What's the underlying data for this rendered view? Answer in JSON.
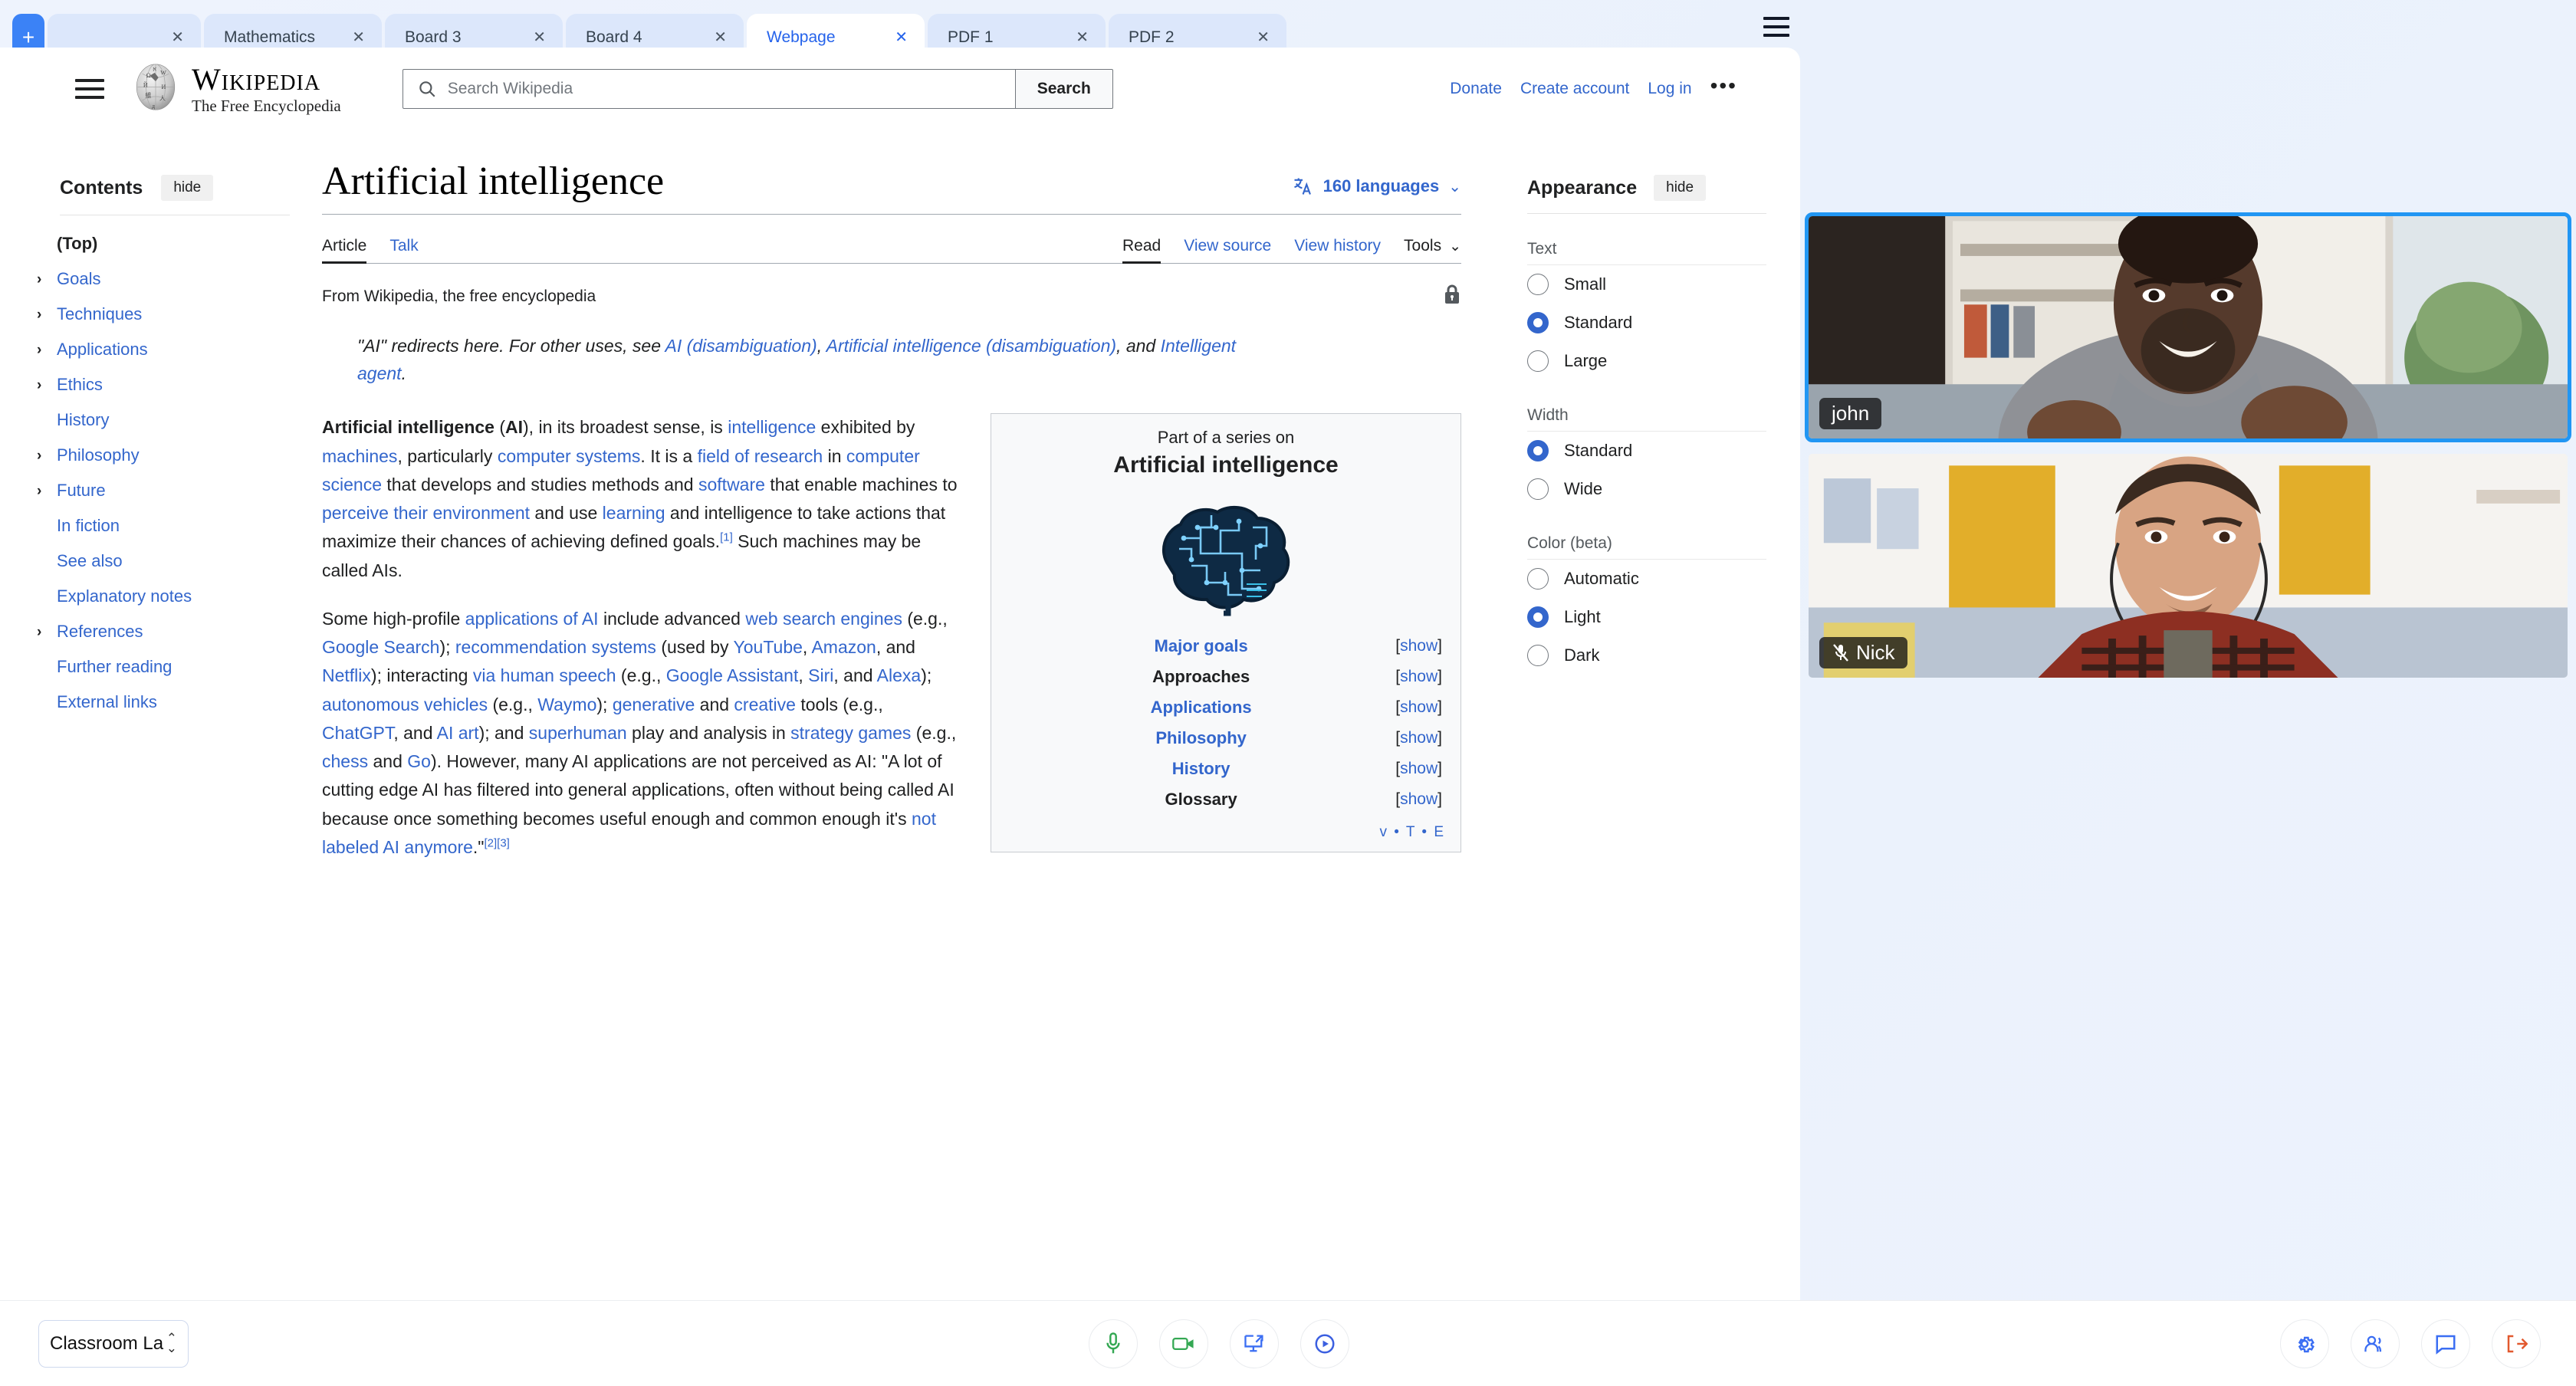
{
  "tabbar": {
    "new_tab_label": "+",
    "menu_icon": "hamburger-icon",
    "close_label": "✕",
    "tabs": [
      {
        "label": "",
        "active": false
      },
      {
        "label": "Mathematics",
        "active": false
      },
      {
        "label": "Board 3",
        "active": false
      },
      {
        "label": "Board 4",
        "active": false
      },
      {
        "label": "Webpage",
        "active": true
      },
      {
        "label": "PDF 1",
        "active": false
      },
      {
        "label": "PDF 2",
        "active": false
      }
    ]
  },
  "wiki": {
    "menu_icon": "hamburger-icon",
    "wordmark": "Wikipedia",
    "tagline": "The Free Encyclopedia",
    "search": {
      "placeholder": "Search Wikipedia",
      "value": "",
      "icon": "search-icon",
      "button_label": "Search"
    },
    "account_links": [
      "Donate",
      "Create account",
      "Log in"
    ],
    "more_label": "•••"
  },
  "toc": {
    "heading": "Contents",
    "hide_label": "hide",
    "items": [
      {
        "label": "(Top)",
        "expandable": false,
        "top": true
      },
      {
        "label": "Goals",
        "expandable": true
      },
      {
        "label": "Techniques",
        "expandable": true
      },
      {
        "label": "Applications",
        "expandable": true
      },
      {
        "label": "Ethics",
        "expandable": true
      },
      {
        "label": "History",
        "expandable": false
      },
      {
        "label": "Philosophy",
        "expandable": true
      },
      {
        "label": "Future",
        "expandable": true
      },
      {
        "label": "In fiction",
        "expandable": false
      },
      {
        "label": "See also",
        "expandable": false
      },
      {
        "label": "Explanatory notes",
        "expandable": false
      },
      {
        "label": "References",
        "expandable": true
      },
      {
        "label": "Further reading",
        "expandable": false
      },
      {
        "label": "External links",
        "expandable": false
      }
    ]
  },
  "article": {
    "title": "Artificial intelligence",
    "languages_label": "160 languages",
    "languages_icon": "translate-icon",
    "namespace_tabs": [
      {
        "label": "Article",
        "selected": true
      },
      {
        "label": "Talk",
        "selected": false
      }
    ],
    "view_tabs": [
      {
        "label": "Read",
        "selected": true
      },
      {
        "label": "View source",
        "selected": false
      },
      {
        "label": "View history",
        "selected": false
      },
      {
        "label": "Tools",
        "selected": false
      }
    ],
    "from_line": "From Wikipedia, the free encyclopedia",
    "protection_icon": "lock-icon",
    "hatnote": {
      "part1": "\"AI\" redirects here. For other uses, see ",
      "link1": "AI (disambiguation)",
      "sep1": ", ",
      "link2": "Artificial intelligence (disambiguation)",
      "sep2": ", and ",
      "link3": "Intelligent agent",
      "end": "."
    },
    "paragraph1": {
      "bold_lead": "Artificial intelligence",
      "bold_abbr": "AI",
      "t1": " (",
      "t2": "), in its broadest sense, is ",
      "l1": "intelligence",
      "t3": " exhibited by ",
      "l2": "machines",
      "t4": ", particularly ",
      "l3": "computer systems",
      "t5": ". It is a ",
      "l4": "field of research",
      "t6": " in ",
      "l5": "computer science",
      "t7": " that develops and studies methods and ",
      "l6": "software",
      "t8": " that enable machines to ",
      "l7": "perceive their environment",
      "t9": " and use ",
      "l8": "learning",
      "t10": " and intelligence to take actions that maximize their chances of achieving defined goals.",
      "ref1": "[1]",
      "t11": " Such machines may be called AIs."
    },
    "paragraph2": {
      "t1": "Some high-profile ",
      "l1": "applications of AI",
      "t2": " include advanced ",
      "l2": "web search engines",
      "t3": " (e.g., ",
      "l3": "Google Search",
      "t4": "); ",
      "l4": "recommendation systems",
      "t5": " (used by ",
      "l5": "YouTube",
      "t6": ", ",
      "l6": "Amazon",
      "t7": ", and ",
      "l7": "Netflix",
      "t8": "); interacting ",
      "l8": "via human speech",
      "t9": " (e.g., ",
      "l9": "Google Assistant",
      "t10": ", ",
      "l10": "Siri",
      "t11": ", and ",
      "l11": "Alexa",
      "t12": "); ",
      "l12": "autonomous vehicles",
      "t13": " (e.g., ",
      "l13": "Waymo",
      "t14": "); ",
      "l14": "generative",
      "t15": " and ",
      "l15": "creative",
      "t16": " tools (e.g., ",
      "l16": "ChatGPT",
      "t17": ", and ",
      "l17": "AI art",
      "t18": "); and ",
      "l18": "superhuman",
      "t19": " play and analysis in ",
      "l19": "strategy games",
      "t20": " (e.g., ",
      "l20": "chess",
      "t21": " and ",
      "l21": "Go",
      "t22": "). However, many AI applications are not perceived as AI: \"A lot of cutting edge AI has filtered into general applications, often without being called AI because once something becomes useful enough and common enough it's ",
      "l22": "not labeled AI anymore",
      "t23": ".\"",
      "ref2": "[2]",
      "ref3": "[3]"
    }
  },
  "infobox": {
    "eyebrow": "Part of a series on",
    "title": "Artificial intelligence",
    "image_icon": "circuit-brain-icon",
    "rows": [
      {
        "label": "Major goals",
        "is_link": true,
        "show": "show"
      },
      {
        "label": "Approaches",
        "is_link": false,
        "show": "show"
      },
      {
        "label": "Applications",
        "is_link": true,
        "show": "show"
      },
      {
        "label": "Philosophy",
        "is_link": true,
        "show": "show"
      },
      {
        "label": "History",
        "is_link": true,
        "show": "show"
      },
      {
        "label": "Glossary",
        "is_link": false,
        "show": "show"
      }
    ],
    "vte": [
      "v",
      "T",
      "E"
    ]
  },
  "appearance": {
    "heading": "Appearance",
    "hide_label": "hide",
    "groups": [
      {
        "title": "Text",
        "options": [
          {
            "label": "Small",
            "selected": false
          },
          {
            "label": "Standard",
            "selected": true
          },
          {
            "label": "Large",
            "selected": false
          }
        ]
      },
      {
        "title": "Width",
        "options": [
          {
            "label": "Standard",
            "selected": true
          },
          {
            "label": "Wide",
            "selected": false
          }
        ]
      },
      {
        "title": "Color (beta)",
        "options": [
          {
            "label": "Automatic",
            "selected": false
          },
          {
            "label": "Light",
            "selected": true
          },
          {
            "label": "Dark",
            "selected": false
          }
        ]
      }
    ]
  },
  "video": {
    "participants": [
      {
        "name": "john",
        "muted": false,
        "active_speaker": true
      },
      {
        "name": "Nick",
        "muted": true,
        "active_speaker": false
      }
    ]
  },
  "bottombar": {
    "class_selector_value": "Classroom La",
    "center_buttons": [
      {
        "icon": "microphone-icon",
        "color": "#34a853"
      },
      {
        "icon": "video-camera-icon",
        "color": "#34a853"
      },
      {
        "icon": "screen-share-icon",
        "color": "#3b6ef3"
      },
      {
        "icon": "record-play-icon",
        "color": "#3b5fe0"
      }
    ],
    "right_buttons": [
      {
        "icon": "gear-icon",
        "color": "#3b6ef3"
      },
      {
        "icon": "participants-icon",
        "color": "#3b6ef3"
      },
      {
        "icon": "chat-bubble-icon",
        "color": "#3b6ef3"
      },
      {
        "icon": "leave-call-icon",
        "color": "#e2592e"
      }
    ]
  },
  "colors": {
    "accent_blue": "#3366cc",
    "tab_active": "#2563eb",
    "tab_bg": "#dce7fb",
    "new_tab_bg": "#3b82f6",
    "page_bg": "#eef3fd",
    "speaker_border": "#2196f3"
  }
}
